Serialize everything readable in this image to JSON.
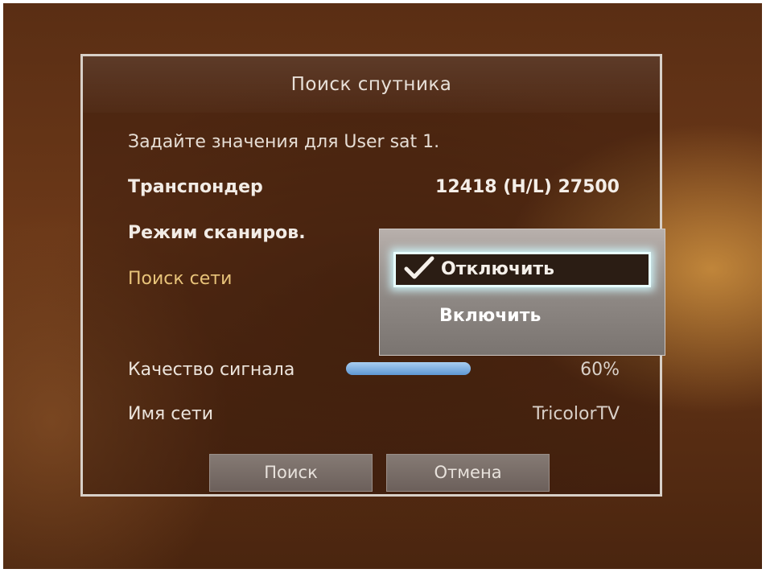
{
  "dialog": {
    "title": "Поиск спутника",
    "hint": "Задайте значения для User sat 1."
  },
  "rows": {
    "transponder": {
      "label": "Транспондер",
      "value": "12418 (H/L) 27500"
    },
    "scan_mode": {
      "label": "Режим сканиров."
    },
    "network_search": {
      "label": "Поиск сети"
    },
    "signal_quality": {
      "label": "Качество сигнала",
      "value": "60%",
      "level": 0.6
    },
    "network_name": {
      "label": "Имя сети",
      "value": "TricolorTV"
    }
  },
  "buttons": {
    "search": "Поиск",
    "cancel": "Отмена"
  },
  "popup": {
    "options": [
      "Отключить",
      "Включить"
    ],
    "selected_index": 0,
    "selected_icon": "checkmark-icon"
  },
  "colors": {
    "focus_label": "#e8c37a",
    "selection_glow": "#e8ffff",
    "signal_bar": "#5f98d4"
  }
}
